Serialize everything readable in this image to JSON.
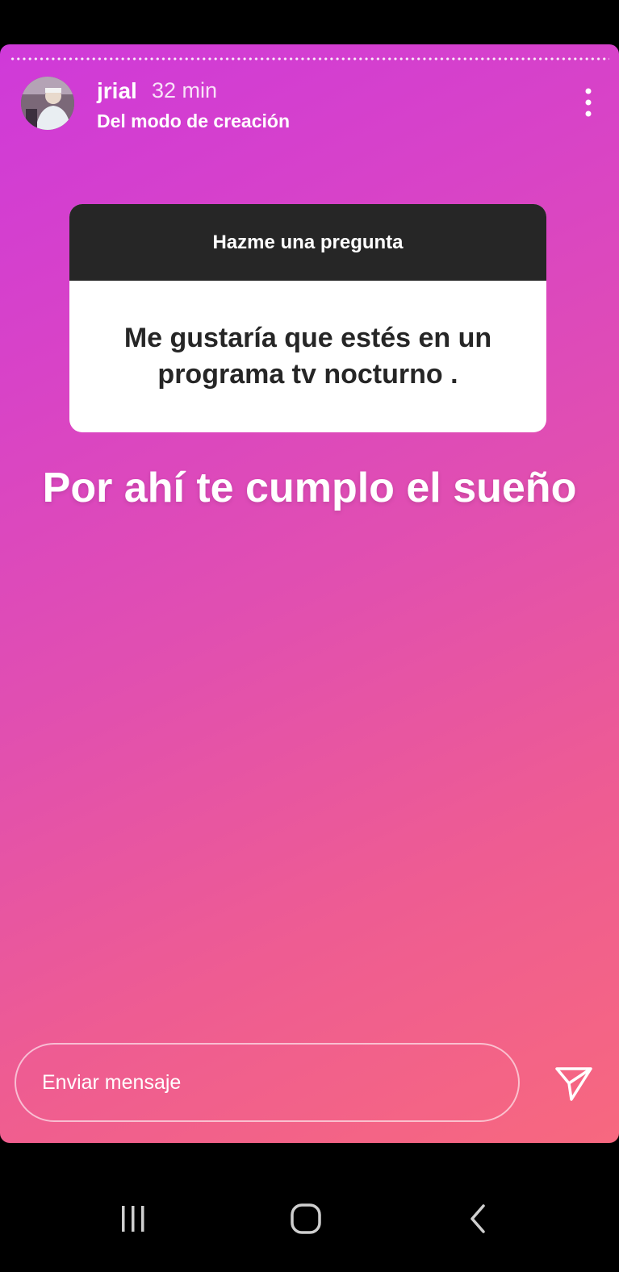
{
  "story": {
    "username": "jrial",
    "time": "32 min",
    "subtitle": "Del modo de creación",
    "question_header": "Hazme una pregunta",
    "question_text": "Me gustaría que estés en un programa tv nocturno .",
    "answer_text": "Por ahí te cumplo el sueño"
  },
  "footer": {
    "message_placeholder": "Enviar mensaje"
  },
  "icons": {
    "more": "more-vertical-icon",
    "send": "send-icon",
    "recents": "recent-apps-icon",
    "home": "home-icon",
    "back": "back-icon"
  },
  "colors": {
    "gradient_start": "#cf3ad9",
    "gradient_end": "#f7687f",
    "question_header_bg": "#262626"
  }
}
